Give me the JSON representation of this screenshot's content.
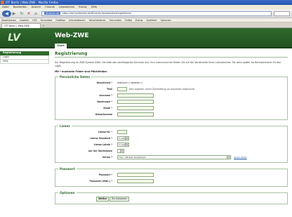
{
  "browser": {
    "title": "LTF Berlin | Web-ZWE - Mozilla Firefox",
    "menu": [
      "Datei",
      "Bearbeiten",
      "Ansicht",
      "Chronik",
      "Lesezeichen",
      "Extras",
      "Hilfe"
    ],
    "url_highlight": "ltf-berlin.de",
    "url": "https://ssl.lsvdienste.de/ltf-berlin.de/zwe/start/registrieren",
    "bookmarks": [
      "Deaktivieren",
      "Cookies",
      "CSS",
      "Formulare",
      "Grafiken",
      "Informationen",
      "Verschiedenes",
      "Umranden",
      "Größe",
      "Extras",
      "Quelltext",
      "Optionen"
    ],
    "tab_title": "LTF Berlin | Web-ZWE",
    "new_tab": "+"
  },
  "site": {
    "logo_text": "LV",
    "brand": "Web-ZWE",
    "start_tab": "Start"
  },
  "sidebar": {
    "items": [
      {
        "label": "Registrierung"
      },
      {
        "label": "Login"
      },
      {
        "label": "Hilfe"
      }
    ]
  },
  "page": {
    "title": "Registrierung",
    "intro": "Zur Registrierung im ZWE-System füllen Sie bitte das nachfolgende Formular aus. Ihre Lizenznummer finden Sie auf der Vorderseite Ihres Lizenzbuches. Sie dann später als Benutzername für den Login.",
    "required_note": "Mit * markierte Felder sind Pflichtfelder."
  },
  "personal": {
    "legend": "Persönliche Daten",
    "gender_label": "Geschlecht *",
    "gender_options": "männlich  ○  weiblich  ○",
    "title_label": "Titel",
    "title_note": "(Nur angeben, wenn Übermittlung an Ausrichter erwünscht)",
    "firstname_label": "Vorname *",
    "lastname_label": "Nachname *",
    "email_label": "Email *",
    "birthname_label": "Geburtsname"
  },
  "license": {
    "legend": "Lizenz",
    "number_label": "Lizenz-Nr. *",
    "standard_label": "Lizenz Standard *",
    "standard_value": "C-Lizenz",
    "latin_label": "Lizenz Latein *",
    "latin_value": "C-Lizenz",
    "class_label": "nur bei Startklasse",
    "class_value": "",
    "club_label": "Verein *",
    "club_value": "TSA i. SB Zum Rosenheim",
    "club_missing": "Verein fehlt?"
  },
  "password": {
    "legend": "Passwort",
    "pw_label": "Passwort *",
    "pw_repeat_label": "Passwort (Wdh.) *"
  },
  "options": {
    "legend": "Optionen",
    "next_button": "Weiter",
    "reset_button": "Zurücksetzen"
  }
}
